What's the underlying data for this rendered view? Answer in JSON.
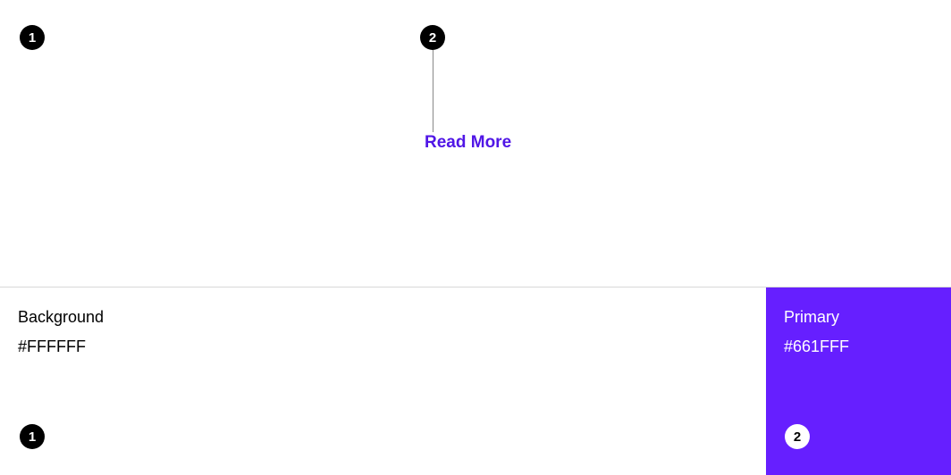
{
  "callouts": {
    "upper": {
      "one": "1",
      "two": "2"
    },
    "lower": {
      "one": "1",
      "two": "2"
    }
  },
  "link": {
    "read_more": "Read More"
  },
  "swatches": {
    "background": {
      "label": "Background",
      "hex": "#FFFFFF"
    },
    "primary": {
      "label": "Primary",
      "hex": "#661FFF"
    }
  }
}
